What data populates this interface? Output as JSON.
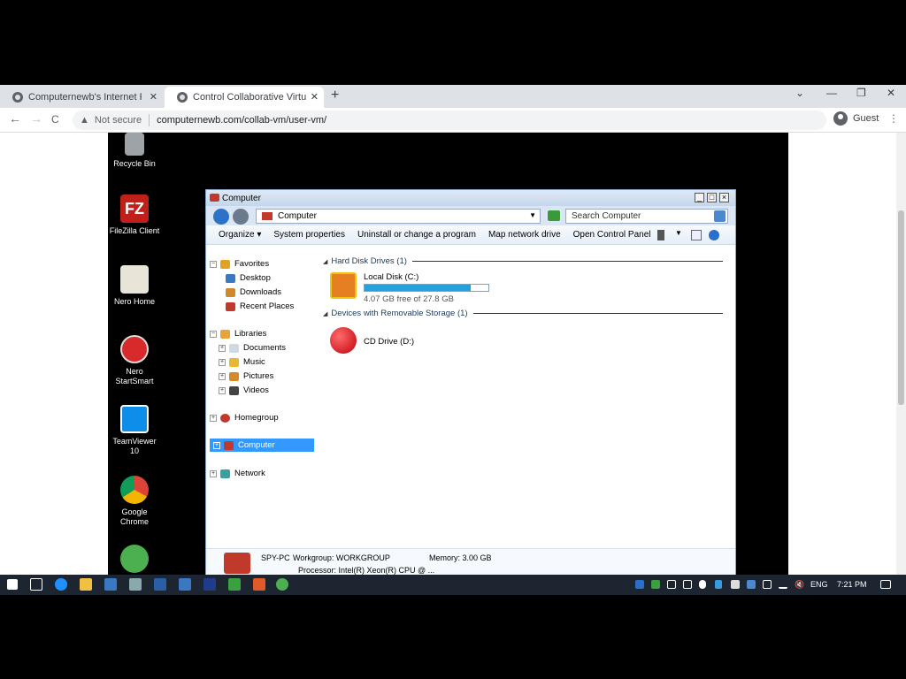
{
  "browser": {
    "tabs": [
      {
        "title": "Computernewb's Internet Pub H"
      },
      {
        "title": "Control Collaborative Virtual Ma"
      }
    ],
    "new_tab": "+",
    "controls": {
      "dropdown": "⌄",
      "minimize": "—",
      "maximize": "❐",
      "close": "✕",
      "tab_close": "✕"
    },
    "nav": {
      "back": "←",
      "forward": "→",
      "reload": "C"
    },
    "security_label": "Not secure",
    "url": "computernewb.com/collab-vm/user-vm/",
    "profile_label": "Guest",
    "menu": "⋮"
  },
  "desktop_icons": [
    {
      "label": "Recycle Bin",
      "icon": "recycle-bin-icon",
      "color": "#9ea3a8"
    },
    {
      "label": "FileZilla Client",
      "icon": "filezilla-icon",
      "color": "#c0201a"
    },
    {
      "label": "Nero Home",
      "icon": "nero-home-icon",
      "color": "#e8e4d8"
    },
    {
      "label": "Nero StartSmart",
      "icon": "nero-startsmart-icon",
      "color": "#d82a2a"
    },
    {
      "label": "TeamViewer 10",
      "icon": "teamviewer-icon",
      "color": "#0e8ee9"
    },
    {
      "label": "Google Chrome",
      "icon": "chrome-icon",
      "color": "#4caf50"
    }
  ],
  "explorer": {
    "title": "Computer",
    "address": "Computer",
    "search_placeholder": "Search Computer",
    "toolbar": {
      "organize": "Organize ▾",
      "system_properties": "System properties",
      "uninstall": "Uninstall or change a program",
      "map_drive": "Map network drive",
      "control_panel": "Open Control Panel"
    },
    "nav": {
      "favorites": "Favorites",
      "desktop": "Desktop",
      "downloads": "Downloads",
      "recent": "Recent Places",
      "libraries": "Libraries",
      "documents": "Documents",
      "music": "Music",
      "pictures": "Pictures",
      "videos": "Videos",
      "homegroup": "Homegroup",
      "computer": "Computer",
      "network": "Network"
    },
    "groups": {
      "hdd": "Hard Disk Drives (1)",
      "removable": "Devices with Removable Storage (1)"
    },
    "local_disk": {
      "name": "Local Disk (C:)",
      "free_text": "4.07 GB free of 27.8 GB",
      "used_fraction": 0.854
    },
    "cd_drive": {
      "name": "CD Drive (D:)"
    },
    "details": {
      "pc_name": "SPY-PC",
      "workgroup": "Workgroup: WORKGROUP",
      "memory": "Memory: 3.00 GB",
      "processor": "Processor: Intel(R) Xeon(R) CPU @ ..."
    }
  },
  "taskbar": {
    "language": "ENG",
    "time": "7:21 PM"
  }
}
